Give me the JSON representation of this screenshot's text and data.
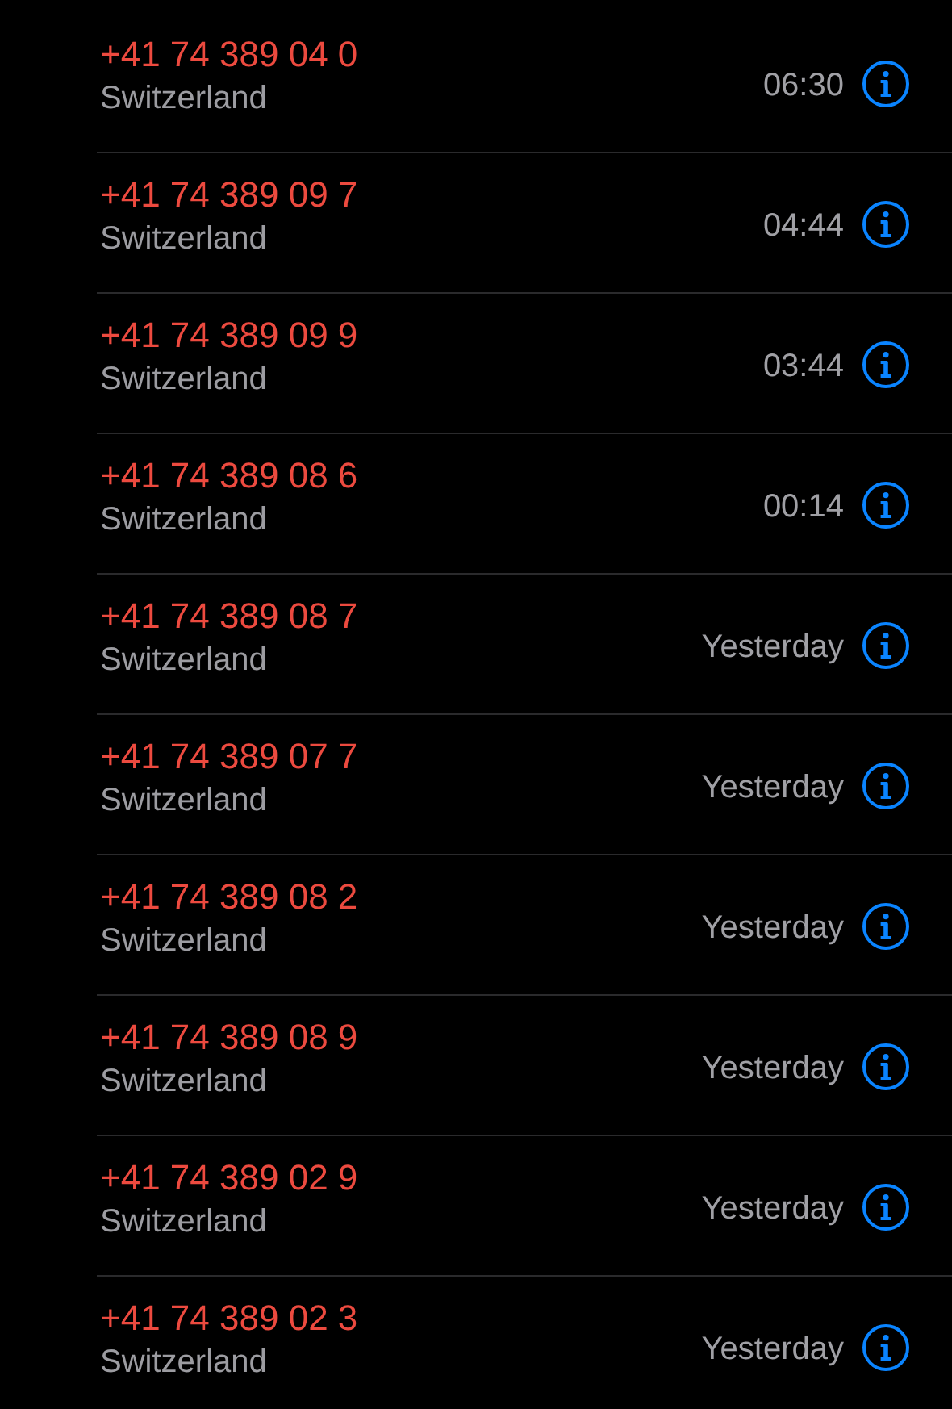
{
  "calls": [
    {
      "number": "+41 74 389 04 0",
      "location": "Switzerland",
      "time": "06:30"
    },
    {
      "number": "+41 74 389 09 7",
      "location": "Switzerland",
      "time": "04:44"
    },
    {
      "number": "+41 74 389 09 9",
      "location": "Switzerland",
      "time": "03:44"
    },
    {
      "number": "+41 74 389 08 6",
      "location": "Switzerland",
      "time": "00:14"
    },
    {
      "number": "+41 74 389 08 7",
      "location": "Switzerland",
      "time": "Yesterday"
    },
    {
      "number": "+41 74 389 07 7",
      "location": "Switzerland",
      "time": "Yesterday"
    },
    {
      "number": "+41 74 389 08 2",
      "location": "Switzerland",
      "time": "Yesterday"
    },
    {
      "number": "+41 74 389 08 9",
      "location": "Switzerland",
      "time": "Yesterday"
    },
    {
      "number": "+41 74 389 02 9",
      "location": "Switzerland",
      "time": "Yesterday"
    },
    {
      "number": "+41 74 389 02 3",
      "location": "Switzerland",
      "time": "Yesterday"
    }
  ]
}
